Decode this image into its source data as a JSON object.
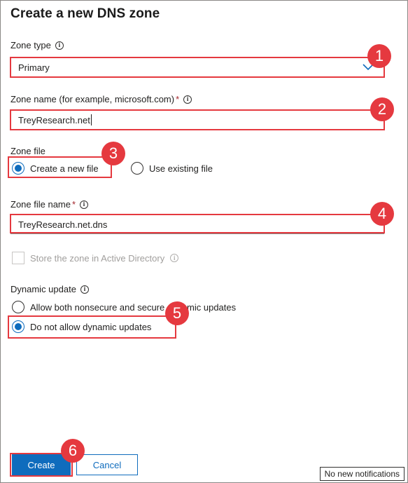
{
  "dialog": {
    "title": "Create a new DNS zone"
  },
  "zone_type": {
    "label": "Zone type",
    "value": "Primary"
  },
  "zone_name": {
    "label": "Zone name (for example, microsoft.com)",
    "required_mark": "*",
    "value": "TreyResearch.net"
  },
  "zone_file": {
    "label": "Zone file",
    "options": [
      "Create a new file",
      "Use existing file"
    ],
    "selected": "Create a new file"
  },
  "zone_file_name": {
    "label": "Zone file name",
    "required_mark": "*",
    "value": "TreyResearch.net.dns"
  },
  "store_in_ad": {
    "label": "Store the zone in Active Directory",
    "checked": false,
    "disabled": true
  },
  "dynamic_update": {
    "label": "Dynamic update",
    "options": [
      "Allow both nonsecure and secure dynamic updates",
      "Do not allow dynamic updates"
    ],
    "selected": "Do not allow dynamic updates"
  },
  "buttons": {
    "create": "Create",
    "cancel": "Cancel"
  },
  "notifications": {
    "text": "No new notifications"
  },
  "callouts": [
    "1",
    "2",
    "3",
    "4",
    "5",
    "6"
  ],
  "colors": {
    "accent": "#0f6cbd",
    "callout": "#e5393f"
  }
}
